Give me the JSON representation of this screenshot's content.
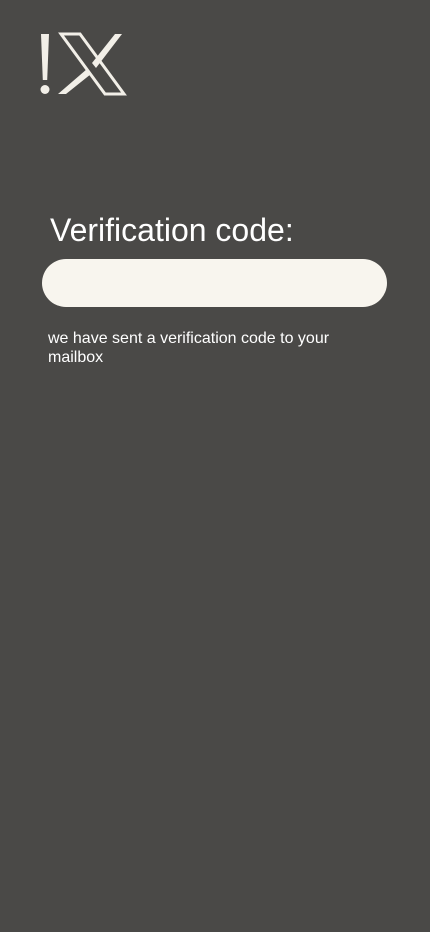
{
  "logo": {
    "icon": "exclamation-x-logo",
    "color": "#f2efe8"
  },
  "verification": {
    "title": "Verification code:",
    "code_value": "",
    "code_placeholder": "",
    "helper_text": "we have sent a verification code to your mailbox"
  },
  "colors": {
    "background": "#4a4947",
    "input_background": "#f8f5ee",
    "text": "#ffffff"
  }
}
